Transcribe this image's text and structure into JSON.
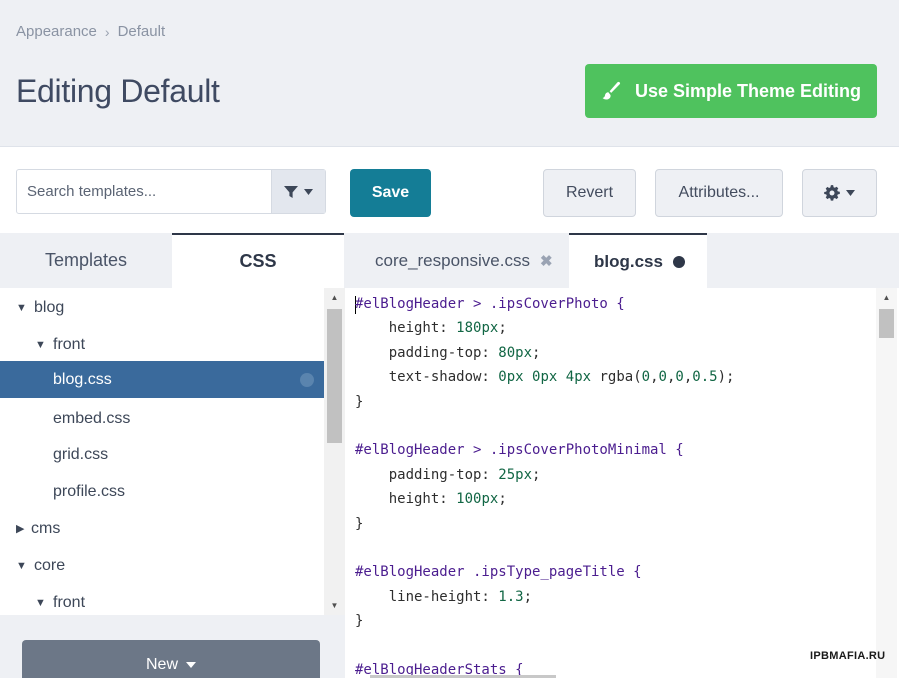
{
  "breadcrumb": {
    "items": [
      "Appearance",
      "Default"
    ],
    "separator": "›"
  },
  "page": {
    "title": "Editing Default"
  },
  "simple_button": {
    "label": "Use Simple Theme Editing",
    "icon": "brush-icon",
    "color": "#4fc25e"
  },
  "search": {
    "placeholder": "Search templates...",
    "value": ""
  },
  "toolbar": {
    "save_label": "Save",
    "revert_label": "Revert",
    "attributes_label": "Attributes...",
    "save_color": "#147d96"
  },
  "side_tabs": [
    {
      "label": "Templates",
      "active": false
    },
    {
      "label": "CSS",
      "active": true
    }
  ],
  "file_tabs": [
    {
      "label": "core_responsive.css",
      "active": false
    },
    {
      "label": "blog.css",
      "active": true
    }
  ],
  "tree": [
    {
      "label": "blog",
      "caret": "down",
      "level": 0
    },
    {
      "label": "front",
      "caret": "down",
      "level": 1
    },
    {
      "label": "blog.css",
      "caret": "",
      "level": 2,
      "selected": true
    },
    {
      "label": "embed.css",
      "caret": "",
      "level": 2
    },
    {
      "label": "grid.css",
      "caret": "",
      "level": 2
    },
    {
      "label": "profile.css",
      "caret": "",
      "level": 2
    },
    {
      "label": "cms",
      "caret": "right",
      "level": 0
    },
    {
      "label": "core",
      "caret": "down",
      "level": 0
    },
    {
      "label": "front",
      "caret": "down",
      "level": 1
    }
  ],
  "new_button": {
    "label": "New"
  },
  "code_lines": [
    "#elBlogHeader > .ipsCoverPhoto {",
    "    height: 180px;",
    "    padding-top: 80px;",
    "    text-shadow: 0px 0px 4px rgba(0,0,0,0.5);",
    "}",
    "",
    "#elBlogHeader > .ipsCoverPhotoMinimal {",
    "    padding-top: 25px;",
    "    height: 100px;",
    "}",
    "",
    "#elBlogHeader .ipsType_pageTitle {",
    "    line-height: 1.3;",
    "}",
    "",
    "#elBlogHeaderStats {"
  ],
  "watermark": "IPBMAFIA.RU"
}
